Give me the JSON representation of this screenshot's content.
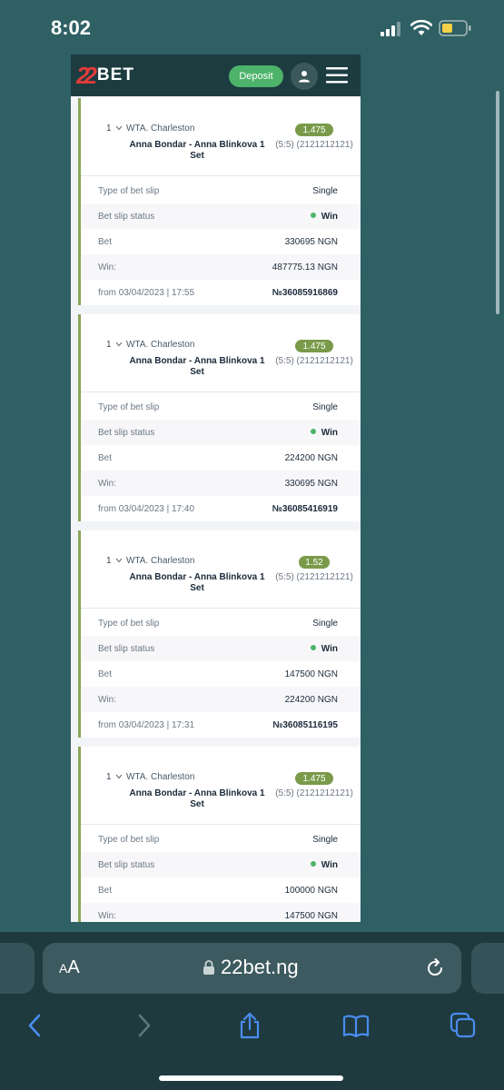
{
  "status_bar": {
    "time": "8:02"
  },
  "header": {
    "brand_digits": "22",
    "brand_word": "BET",
    "deposit_label": "Deposit"
  },
  "labels": {
    "type": "Type of bet slip",
    "status": "Bet slip status",
    "bet": "Bet",
    "win": "Win:"
  },
  "bets": [
    {
      "num": "1",
      "league": "WTA. Charleston",
      "match": "Anna Bondar - Anna Blinkova 1 Set",
      "odds": "1.475",
      "score": "(5:5) (2121212121)",
      "type": "Single",
      "status": "Win",
      "bet": "330695 NGN",
      "win": "487775.13 NGN",
      "date": "from 03/04/2023 | 17:55",
      "id": "№36085916869"
    },
    {
      "num": "1",
      "league": "WTA. Charleston",
      "match": "Anna Bondar - Anna Blinkova 1 Set",
      "odds": "1.475",
      "score": "(5:5) (2121212121)",
      "type": "Single",
      "status": "Win",
      "bet": "224200 NGN",
      "win": "330695 NGN",
      "date": "from 03/04/2023 | 17:40",
      "id": "№36085416919"
    },
    {
      "num": "1",
      "league": "WTA. Charleston",
      "match": "Anna Bondar - Anna Blinkova 1 Set",
      "odds": "1.52",
      "score": "(5:5) (2121212121)",
      "type": "Single",
      "status": "Win",
      "bet": "147500 NGN",
      "win": "224200 NGN",
      "date": "from 03/04/2023 | 17:31",
      "id": "№36085116195"
    },
    {
      "num": "1",
      "league": "WTA. Charleston",
      "match": "Anna Bondar - Anna Blinkova 1 Set",
      "odds": "1.475",
      "score": "(5:5) (2121212121)",
      "type": "Single",
      "status": "Win",
      "bet": "100000 NGN",
      "win": "147500 NGN",
      "date": "",
      "id": ""
    }
  ],
  "browser": {
    "text_size_small": "A",
    "text_size_large": "A",
    "url": "22bet.ng"
  },
  "colors": {
    "page_bg": "#2e6064",
    "header_bg": "#1c3c40",
    "accent_green": "#4db36a",
    "odds_badge": "#7a9a4a",
    "card_border": "#8aa55a",
    "brand_red": "#e23b3b"
  },
  "icons": {
    "signal": "signal-icon",
    "wifi": "wifi-icon",
    "battery": "battery-icon",
    "account": "user-icon",
    "menu": "menu-icon",
    "chevron": "chevron-down-icon",
    "lock": "lock-icon",
    "reload": "reload-icon",
    "back": "back-icon",
    "forward": "forward-icon",
    "share": "share-icon",
    "bookmarks": "book-icon",
    "tabs": "tabs-icon"
  }
}
